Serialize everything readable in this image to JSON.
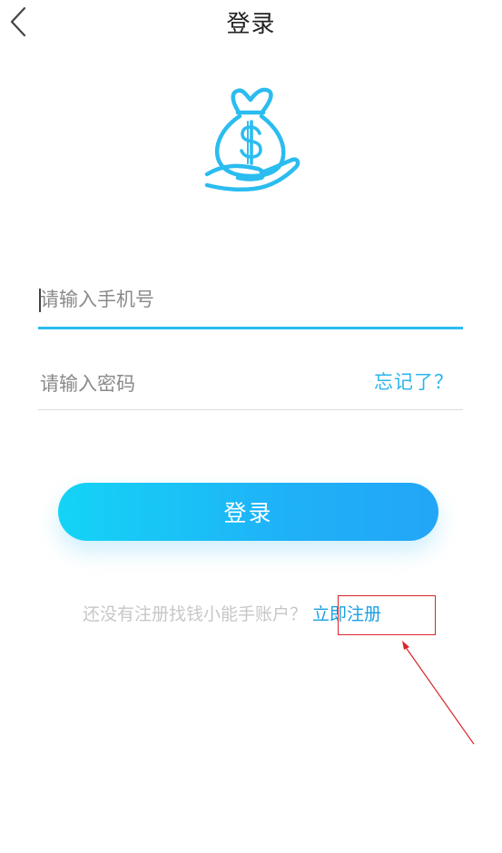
{
  "header": {
    "title": "登录"
  },
  "logo": {
    "icon": "money-bag-in-hand-icon",
    "color": "#2bbcf0"
  },
  "form": {
    "phone_placeholder": "请输入手机号",
    "password_placeholder": "请输入密码",
    "forgot_label": "忘记了？"
  },
  "login_button": {
    "label": "登录"
  },
  "register": {
    "prompt": "还没有注册找钱小能手账户？",
    "link_label": "立即注册"
  },
  "colors": {
    "accent": "#2bbcf0",
    "button_gradient_start": "#14d4f6",
    "button_gradient_end": "#22a6f7",
    "link": "#1aa0e2",
    "annotation": "#d8262a"
  }
}
